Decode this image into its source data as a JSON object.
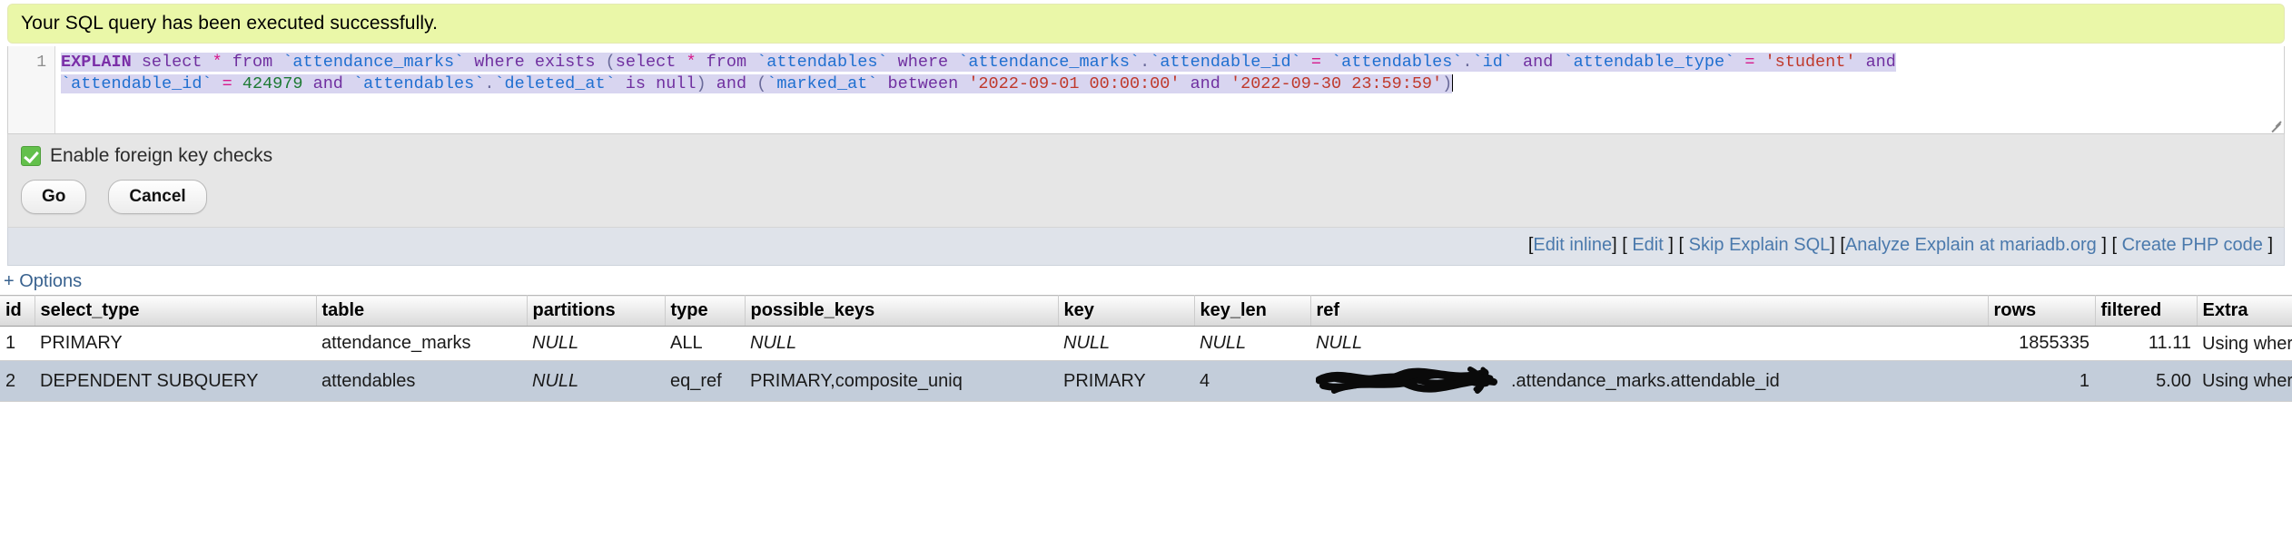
{
  "banner": {
    "message": "Your SQL query has been executed successfully."
  },
  "editor": {
    "line_number": "1",
    "query_full": "EXPLAIN select * from `attendance_marks` where exists (select * from `attendables` where `attendance_marks`.`attendable_id` = `attendables`.`id` and `attendable_type` = 'student' and `attendable_id` = 424979 and `attendables`.`deleted_at` is null) and (`marked_at` between '2022-09-01 00:00:00' and '2022-09-30 23:59:59')",
    "tokens_line1": {
      "t1": "EXPLAIN",
      "t2": "select",
      "t3": "*",
      "t4": "from",
      "t5": "`attendance_marks`",
      "t6": "where exists",
      "t7": "(",
      "t8": "select",
      "t9": "*",
      "t10": "from",
      "t11": "`attendables`",
      "t12": "where",
      "t13": "`attendance_marks`",
      "t14": ".",
      "t15": "`attendable_id`",
      "t16": "=",
      "t17": "`attendables`",
      "t18": ".",
      "t19": "`id`",
      "t20": "and",
      "t21": "`attendable_type`",
      "t22": "=",
      "t23": "'student'",
      "t24": "and"
    },
    "tokens_line2": {
      "t1": "`attendable_id`",
      "t2": "=",
      "t3": "424979",
      "t4": "and",
      "t5": "`attendables`",
      "t6": ".",
      "t7": "`deleted_at`",
      "t8": "is null",
      "t9": ")",
      "t10": "and",
      "t11": "(",
      "t12": "`marked_at`",
      "t13": "between",
      "t14": "'2022-09-01 00:00:00'",
      "t15": "and",
      "t16": "'2022-09-30 23:59:59'",
      "t17": ")"
    }
  },
  "options": {
    "foreign_key_label": "Enable foreign key checks",
    "foreign_key_checked": true,
    "go_label": "Go",
    "cancel_label": "Cancel"
  },
  "links": [
    {
      "open": "[",
      "label": "Edit inline",
      "close": "]"
    },
    {
      "open": "[",
      "label": "Edit",
      "close": "]"
    },
    {
      "open": "[",
      "label": "Skip Explain SQL",
      "close": "]"
    },
    {
      "open": "[",
      "label": "Analyze Explain at mariadb.org",
      "close": "]"
    },
    {
      "open": "[",
      "label": "Create PHP code",
      "close": "]"
    }
  ],
  "options_toggle": {
    "label": "+ Options"
  },
  "explain_table": {
    "headers": [
      "id",
      "select_type",
      "table",
      "partitions",
      "type",
      "possible_keys",
      "key",
      "key_len",
      "ref",
      "rows",
      "filtered",
      "Extra"
    ],
    "rows": [
      {
        "id": "1",
        "select_type": "PRIMARY",
        "table": "attendance_marks",
        "partitions": "NULL",
        "type": "ALL",
        "possible_keys": "NULL",
        "key": "NULL",
        "key_len": "NULL",
        "ref": "NULL",
        "ref_redacted": false,
        "ref_suffix": "",
        "rows": "1855335",
        "filtered": "11.11",
        "extra": "Using where"
      },
      {
        "id": "2",
        "select_type": "DEPENDENT SUBQUERY",
        "table": "attendables",
        "partitions": "NULL",
        "type": "eq_ref",
        "possible_keys": "PRIMARY,composite_uniq",
        "key": "PRIMARY",
        "key_len": "4",
        "ref": "",
        "ref_redacted": true,
        "ref_suffix": ".attendance_marks.attendable_id",
        "rows": "1",
        "filtered": "5.00",
        "extra": "Using where"
      }
    ]
  },
  "colors": {
    "banner_bg": "#eaf7a8",
    "link_blue": "#4a79ac",
    "selection": "#d8d5f0",
    "row_highlight": "#c3cdda",
    "checkbox_green": "#63c04b"
  }
}
